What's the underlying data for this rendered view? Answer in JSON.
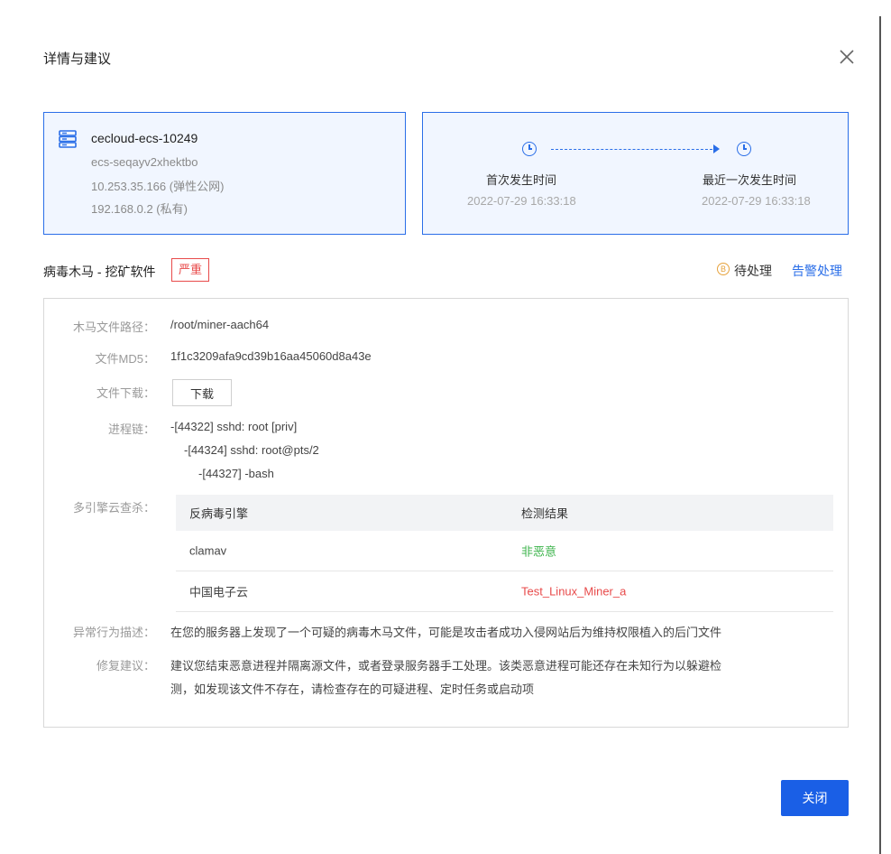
{
  "dialog": {
    "title": "详情与建议",
    "close_label": "关闭"
  },
  "host": {
    "name": "cecloud-ecs-10249",
    "id": "ecs-seqayv2xhektbo",
    "public_ip": "10.253.35.166 (弹性公网)",
    "private_ip": "192.168.0.2 (私有)"
  },
  "timeline": {
    "first_label": "首次发生时间",
    "first_time": "2022-07-29 16:33:18",
    "last_label": "最近一次发生时间",
    "last_time": "2022-07-29 16:33:18"
  },
  "alert": {
    "title": "病毒木马 - 挖矿软件",
    "severity": "严重",
    "status_icon_text": "B",
    "status": "待处理",
    "action_link": "告警处理"
  },
  "detail": {
    "path_label": "木马文件路径：",
    "path_value": "/root/miner-aach64",
    "md5_label": "文件MD5：",
    "md5_value": "1f1c3209afa9cd39b16aa45060d8a43e",
    "download_label": "文件下载：",
    "download_button": "下载",
    "chain_label": "进程链：",
    "chain": [
      "-[44322]  sshd: root [priv]",
      "-[44324]  sshd: root@pts/2",
      "-[44327]  -bash"
    ],
    "engines_label": "多引擎云查杀：",
    "engines_table": {
      "headers": [
        "反病毒引擎",
        "检测结果"
      ],
      "rows": [
        {
          "engine": "clamav",
          "result": "非恶意"
        },
        {
          "engine": "中国电子云",
          "result": "Test_Linux_Miner_a"
        }
      ]
    },
    "desc_label": "异常行为描述：",
    "desc_value": "在您的服务器上发现了一个可疑的病毒木马文件，可能是攻击者成功入侵网站后为维持权限植入的后门文件",
    "fix_label": "修复建议：",
    "fix_line1": "建议您结束恶意进程并隔离源文件，或者登录服务器手工处理。该类恶意进程可能还存在未知行为以躲避检",
    "fix_line2": "测，如发现该文件不存在，请检查存在的可疑进程、定时任务或启动项"
  },
  "colors": {
    "accent": "#2a6ee8",
    "danger": "#e84a4a",
    "safe": "#3bb34a",
    "warning": "#e6a23c",
    "primary_button": "#1a5fe6"
  }
}
